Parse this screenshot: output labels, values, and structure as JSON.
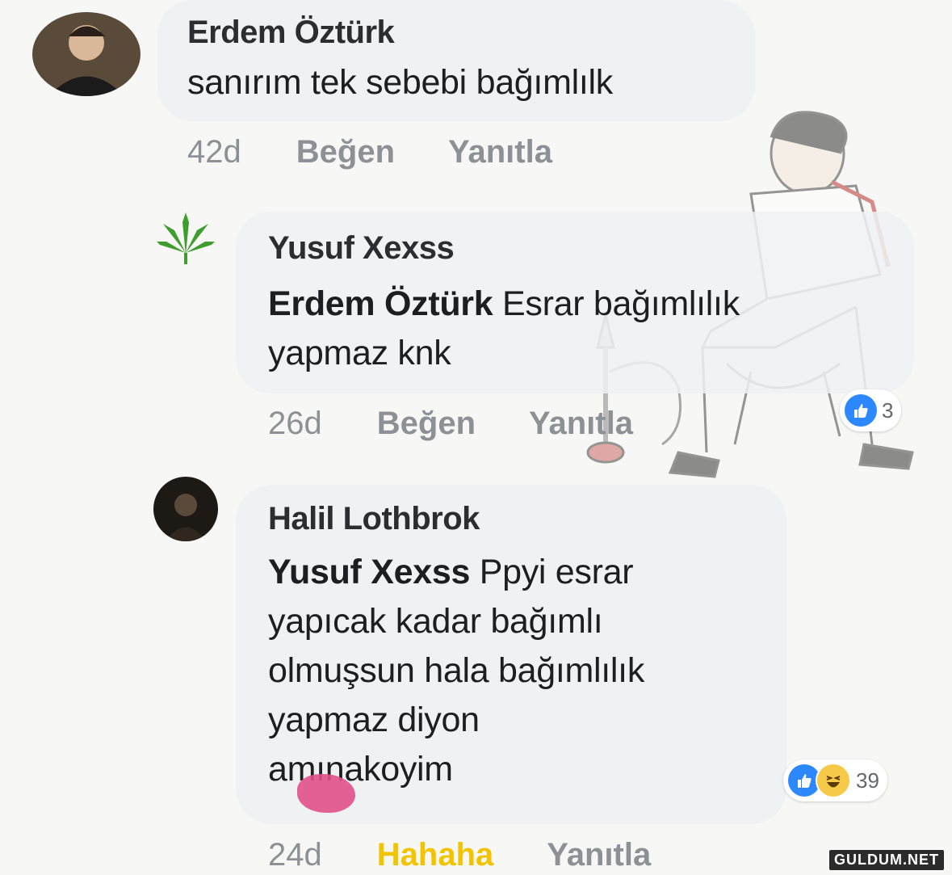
{
  "comments": [
    {
      "author": "Erdem Öztürk",
      "text": "sanırım tek sebebi bağımlılk",
      "time": "42d",
      "like_label": "Beğen",
      "reply_label": "Yanıtla"
    },
    {
      "author": "Yusuf Xexss",
      "mention": "Erdem Öztürk",
      "text_line1": " Esrar bağımlılık",
      "text_line2": "yapmaz knk",
      "time": "26d",
      "like_label": "Beğen",
      "reply_label": "Yanıtla",
      "reaction_count": "3",
      "reactions": [
        "like-icon"
      ]
    },
    {
      "author": "Halil Lothbrok",
      "mention": "Yusuf Xexss",
      "text_line1": " Ppyi esrar",
      "text_line2": "yapıcak kadar bağımlı",
      "text_line3": "olmuşsun hala bağımlılık",
      "text_line4": "yapmaz diyon",
      "text_line5": "amınakoyim",
      "time": "24d",
      "like_label": "Hahaha",
      "reply_label": "Yanıtla",
      "reaction_count": "39",
      "reactions": [
        "like-icon",
        "haha-icon"
      ]
    }
  ],
  "watermark": "GULDUM.NET",
  "colors": {
    "bubble": "#eff1f3",
    "action_gray": "#8d9095",
    "haha_active": "#f2c400",
    "like_blue": "#2d88ff",
    "censor_pink": "#e0508a"
  }
}
